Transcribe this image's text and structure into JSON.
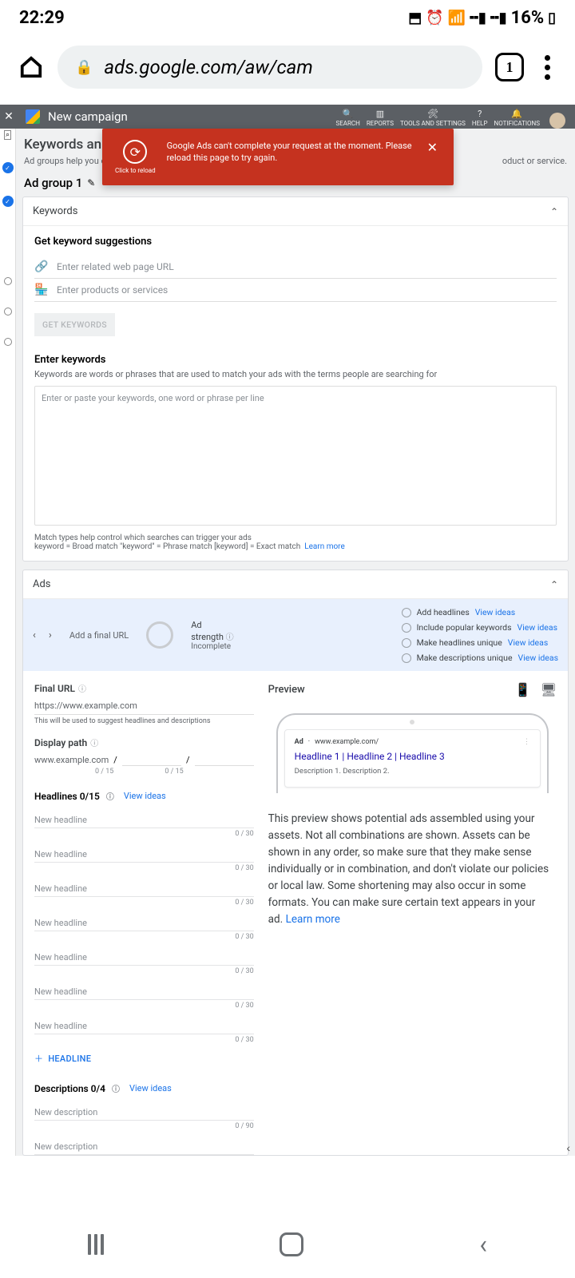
{
  "status": {
    "time": "22:29",
    "battery": "16%"
  },
  "browser": {
    "url": "ads.google.com/aw/cam",
    "tab_count": "1"
  },
  "topbar": {
    "title": "New campaign",
    "nav": {
      "search": "SEARCH",
      "reports": "REPORTS",
      "tools": "TOOLS AND SETTINGS",
      "help": "HELP",
      "notifications": "NOTIFICATIONS"
    }
  },
  "toast": {
    "message": "Google Ads can't complete your request at the moment. Please reload this page to try again.",
    "reload_label": "Click to reload"
  },
  "section": {
    "title": "Keywords an",
    "subtitle_left": "Ad groups help you orga",
    "subtitle_right": "oduct or service.",
    "group_name": "Ad group 1"
  },
  "keywords_card": {
    "header": "Keywords",
    "suggest_title": "Get keyword suggestions",
    "url_placeholder": "Enter related web page URL",
    "prod_placeholder": "Enter products or services",
    "get_btn": "GET KEYWORDS",
    "enter_title": "Enter keywords",
    "enter_sub": "Keywords are words or phrases that are used to match your ads with the terms people are searching for",
    "textarea_placeholder": "Enter or paste your keywords, one word or phrase per line",
    "match_note_1": "Match types help control which searches can trigger your ads",
    "match_note_2": "keyword = Broad match   \"keyword\" = Phrase match   [keyword] = Exact match",
    "learn_more": "Learn more"
  },
  "ads_card": {
    "header": "Ads",
    "add_final_url": "Add a final URL",
    "strength_label": "Ad",
    "strength_label2": "strength",
    "strength_value": "Incomplete",
    "tips": [
      {
        "label": "Add headlines",
        "link": "View ideas"
      },
      {
        "label": "Include popular keywords",
        "link": "View ideas"
      },
      {
        "label": "Make headlines unique",
        "link": "View ideas"
      },
      {
        "label": "Make descriptions unique",
        "link": "View ideas"
      }
    ],
    "final_url_label": "Final URL",
    "final_url_value": "https://www.example.com",
    "final_url_note": "This will be used to suggest headlines and descriptions",
    "display_path_label": "Display path",
    "display_path_base": "www.example.com",
    "dp_count": "0 / 15",
    "headlines_label": "Headlines 0/15",
    "view_ideas": "View ideas",
    "headline_placeholder": "New headline",
    "headline_count": "0 / 30",
    "add_headline": "HEADLINE",
    "descriptions_label": "Descriptions 0/4",
    "description_placeholder": "New description",
    "description_count": "0 / 90",
    "preview_label": "Preview",
    "ad_preview": {
      "badge": "Ad",
      "url": "www.example.com/",
      "headlines": "Headline 1 | Headline 2 | Headline 3",
      "desc": "Description 1. Description 2."
    },
    "preview_text": "This preview shows potential ads assembled using your assets. Not all combinations are shown. Assets can be shown in any order, so make sure that they make sense individually or in combination, and don't violate our policies or local law. Some shortening may also occur in some formats. You can make sure certain text appears in your ad.",
    "preview_learn_more": "Learn more"
  }
}
